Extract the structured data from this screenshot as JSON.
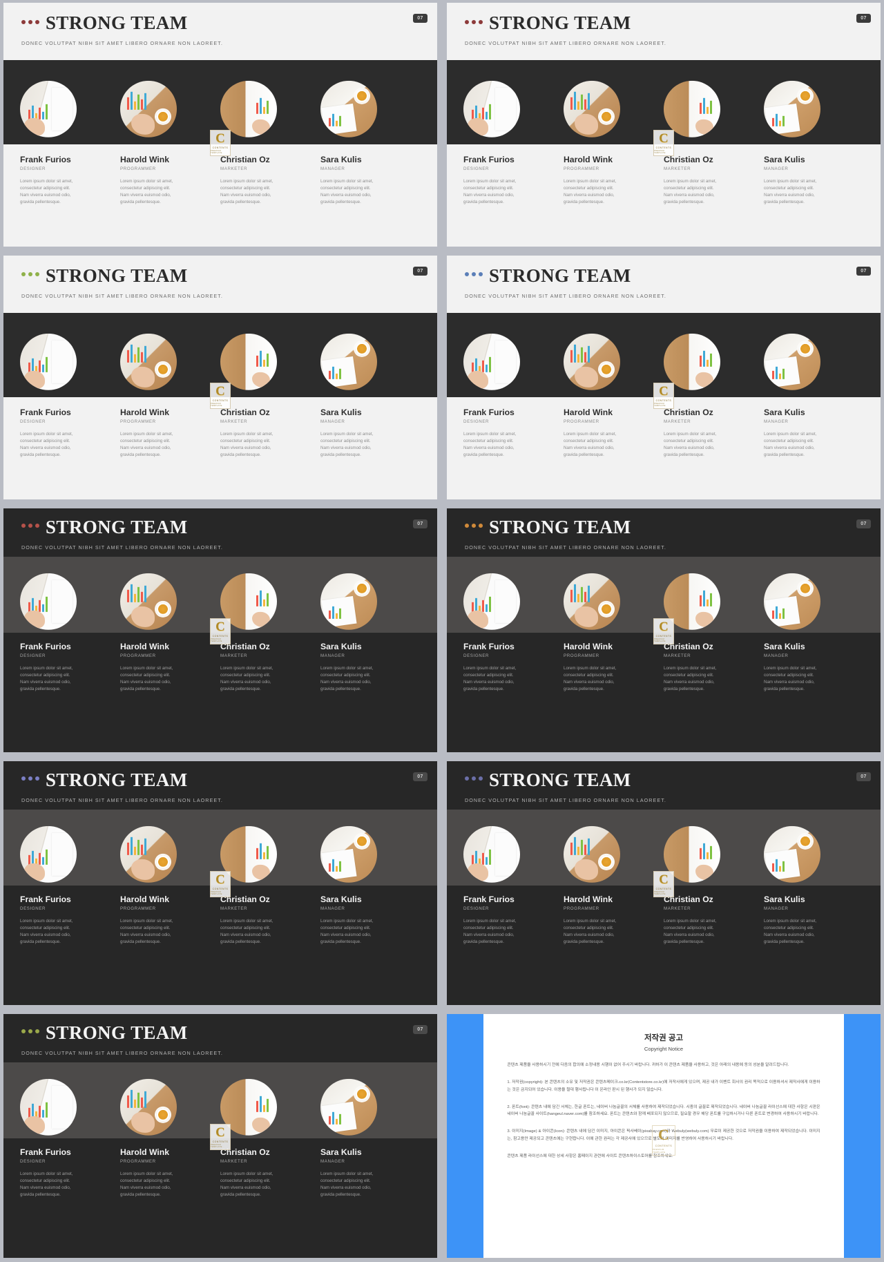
{
  "deck": {
    "title": "STRONG TEAM",
    "subtitle": "DONEC VOLUTPAT  NIBH SIT AMET  LIBERO  ORNARE  NON LAOREET.",
    "page_number": "07",
    "watermark": {
      "letter": "C",
      "line1": "CONTENTS",
      "line2": "PREMIUM TEMPLATE"
    }
  },
  "members": [
    {
      "name": "Frank Furios",
      "role": "DESIGNER",
      "desc": "Lorem ipsum dolor sit amet, consectetur adipiscing elit. Nam viverra euismod odio, gravida pellentesque."
    },
    {
      "name": "Harold Wink",
      "role": "PROGRAMMER",
      "desc": "Lorem ipsum dolor sit amet, consectetur adipiscing elit. Nam viverra euismod odio, gravida pellentesque."
    },
    {
      "name": "Christian Oz",
      "role": "MARKETER",
      "desc": "Lorem ipsum dolor sit amet, consectetur adipiscing elit. Nam viverra euismod odio, gravida pellentesque."
    },
    {
      "name": "Sara Kulis",
      "role": "MANAGER",
      "desc": "Lorem ipsum dolor sit amet, consectetur adipiscing elit. Nam viverra euismod odio, gravida pellentesque."
    }
  ],
  "slides": [
    {
      "id": 1,
      "theme": "light",
      "variant": "tall",
      "dot_color": "#8d3a3a",
      "band_color": "#2c2c2c"
    },
    {
      "id": 2,
      "theme": "light",
      "variant": "tall",
      "dot_color": "#8d3a3a",
      "band_color": "#2c2c2c"
    },
    {
      "id": 3,
      "theme": "light",
      "variant": "tall",
      "dot_color": "#8fb14a",
      "band_color": "#2c2c2c"
    },
    {
      "id": 4,
      "theme": "light",
      "variant": "tall",
      "dot_color": "#5b7fb8",
      "band_color": "#2c2c2c"
    },
    {
      "id": 5,
      "theme": "dark",
      "variant": "compact",
      "dot_color": "#b5524a",
      "band_color": "#4c4a49"
    },
    {
      "id": 6,
      "theme": "dark",
      "variant": "compact",
      "dot_color": "#d08a3a",
      "band_color": "#4c4a49"
    },
    {
      "id": 7,
      "theme": "dark",
      "variant": "compact",
      "dot_color": "#7b7fc4",
      "band_color": "#4c4a49"
    },
    {
      "id": 8,
      "theme": "dark",
      "variant": "compact",
      "dot_color": "#6b6fa8",
      "band_color": "#4c4a49"
    },
    {
      "id": 9,
      "theme": "dark",
      "variant": "compact",
      "dot_color": "#9aa84a",
      "band_color": "#4c4a49"
    }
  ],
  "copyright": {
    "heading_ko": "저작권 공고",
    "heading_en": "Copyright Notice",
    "intro": "콘텐츠 제품을 사용하시기 전에 다음의 합의에 소정내용 시행이 없어 주시기 바랍니다. 귀하가 이 콘텐츠 제품을 사용하고, 것은 아래의 내용에 동의 성분을 알려드립니다.",
    "item1": "1. 저작권(copyright): 본 콘텐츠의 소유 및 저작권은 콘텐츠메이크.co.kr(Contentstore.co.kr)에 저작사에게 있으며, 제공 내가 이벤트 회사의 권리 목적으로 이용하셔서 제작사에게 이용하는 것은 금지되어 있습니다. 이용을 절대 행사됩니다 이 온라인 판시 된 행사가 되지 않습니다.",
    "item2": "2. 폰트(font): 콘텐츠 내에 담긴 서체는, 한글 폰트는, 네이버 나눔글꼴의 서체를 사용하여 제작되었습니다. 시중의 글꼴로 제작되었습니다. 네이버 나눔글꼴 라이선스에 대한 사항은 시판은 네이버 나눔글꼴 사이트(hangeul.naver.com)를 참조하세요. 폰트는 콘텐츠와 함께 배포되지 않으므로, 필요할 경우 해당 폰트를 구입하시거나 다른 폰트로 변경하여 사용하시기 바랍니다.",
    "item3": "3. 이미지(Image) & 아이콘(Icon): 콘텐츠 내에 담긴 이미지, 아이콘은 픽사베이(pixabay.com)와 Webuly(webuly.com) 무료이 제공한 것으로 저작권을 이용하여 제작되었습니다. 이미지는, 참고용만 제공되고 콘텐츠에는 구현합니다. 이에 관한 권리는 각 제공사에 있으므로 별도의 이미지를 반영하여 사용하시기 바랍니다.",
    "footer": "콘텐츠 제품 라이선스에 대한 상세 사항은 홈페이지 관련에 사이트 콘텐츠하이스토어를 참조하세요."
  }
}
